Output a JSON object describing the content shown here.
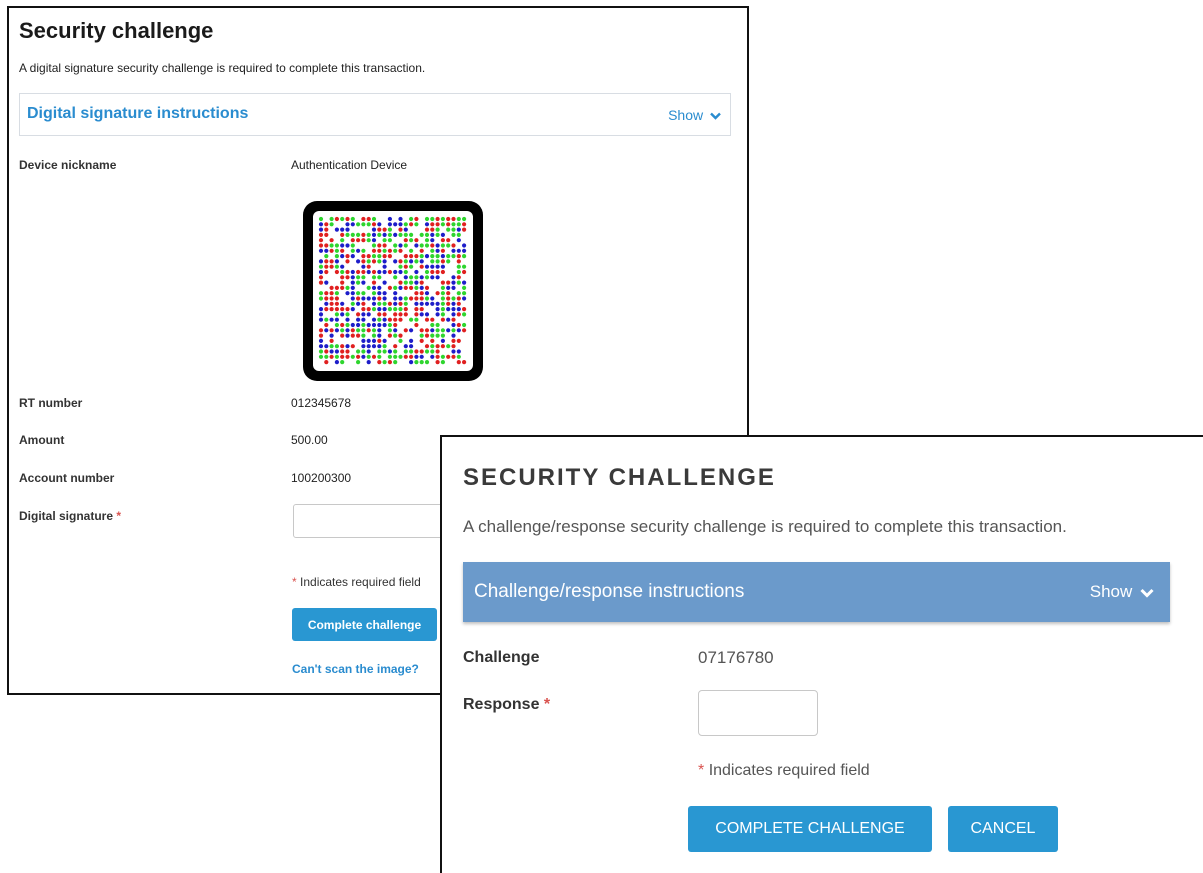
{
  "panel1": {
    "title": "Security challenge",
    "subtitle": "A digital signature security challenge is required to complete this transaction.",
    "instructions": {
      "title": "Digital signature instructions",
      "toggle_label": "Show",
      "toggle_icon": "chevron-down-icon"
    },
    "fields": [
      {
        "label": "Device nickname",
        "value": "Authentication Device"
      },
      {
        "label": "RT number",
        "value": "012345678"
      },
      {
        "label": "Amount",
        "value": "500.00"
      },
      {
        "label": "Account number",
        "value": "100200300"
      },
      {
        "label": "Digital signature",
        "value": ""
      }
    ],
    "required_marker": "*",
    "required_note": "Indicates required field",
    "complete_button": "Complete challenge",
    "cant_scan_link": "Can't scan the image?",
    "qr_colors": [
      "#e02020",
      "#2ed52e",
      "#1d1dc9"
    ]
  },
  "panel2": {
    "title": "SECURITY CHALLENGE",
    "subtitle": "A challenge/response security challenge is required to complete this transaction.",
    "instructions": {
      "title": "Challenge/response instructions",
      "toggle_label": "Show",
      "toggle_icon": "chevron-down-icon"
    },
    "challenge_label": "Challenge",
    "challenge_value": "07176780",
    "response_label": "Response",
    "required_marker": "*",
    "required_note": "Indicates required field",
    "complete_button": "COMPLETE CHALLENGE",
    "cancel_button": "CANCEL",
    "accent_color": "#2997d2",
    "header_color": "#6b9acb"
  }
}
